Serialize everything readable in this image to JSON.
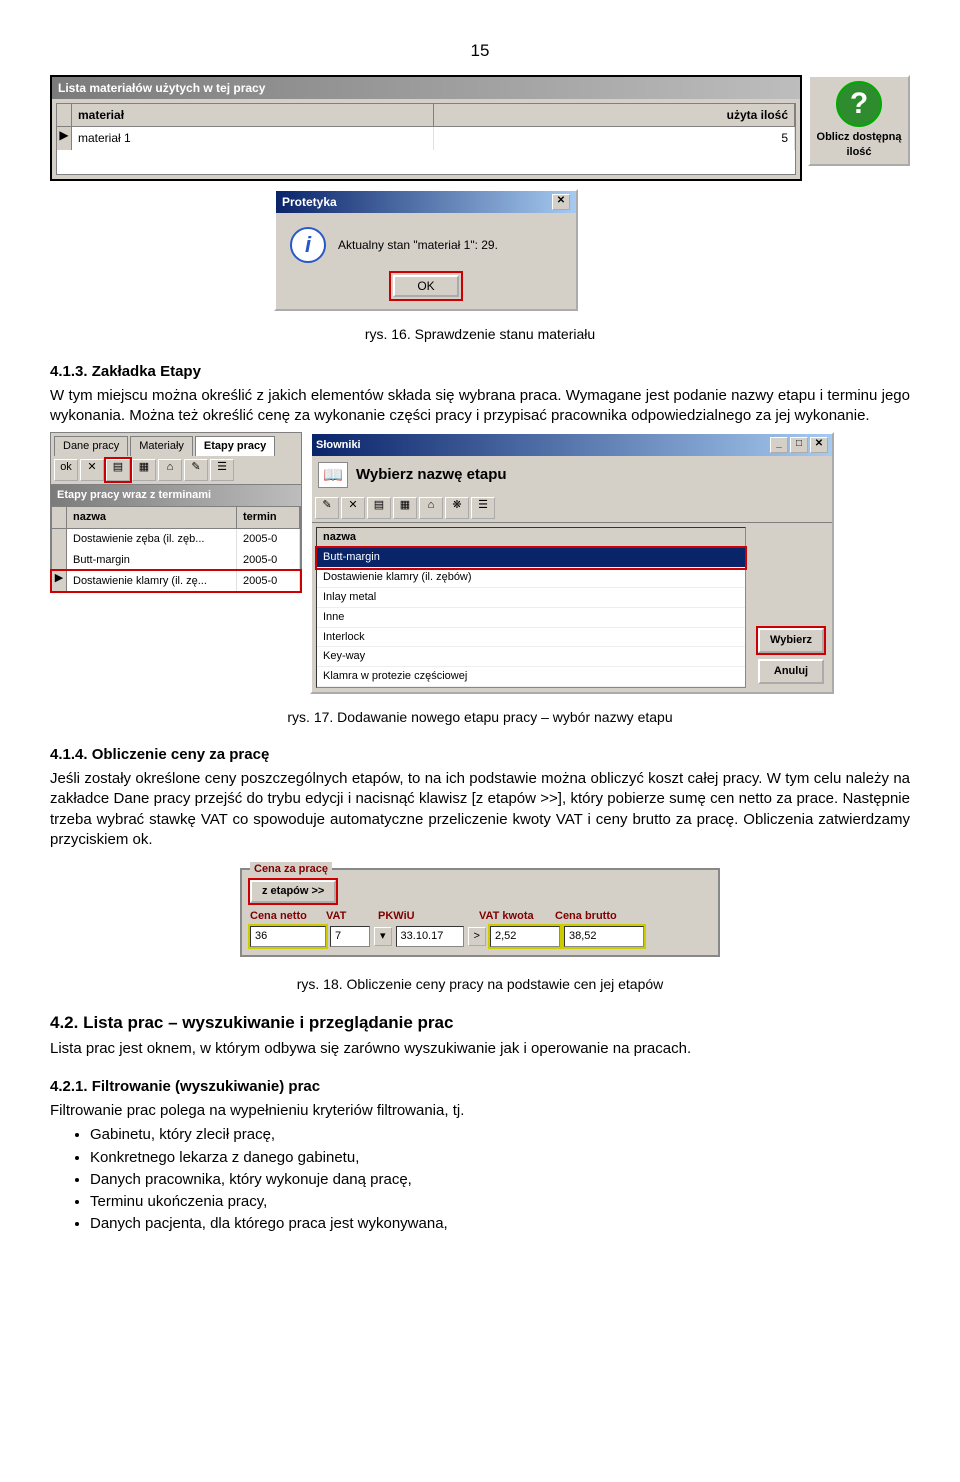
{
  "page_number": "15",
  "fig16": {
    "panel_title": "Lista materiałów użytych w tej pracy",
    "col_material": "materiał",
    "col_qty": "użyta ilość",
    "row_material": "materiał 1",
    "row_qty": "5",
    "oblicz_btn": "Oblicz dostępną ilość",
    "dialog_title": "Protetyka",
    "dialog_msg": "Aktualny stan \"materiał 1\": 29.",
    "ok": "OK",
    "caption": "rys. 16. Sprawdzenie stanu materiału"
  },
  "sec413": {
    "title": "4.1.3. Zakładka Etapy",
    "p1": "W tym miejscu można określić z jakich elementów składa się wybrana praca. Wymagane jest podanie nazwy etapu i terminu jego wykonania. Można też określić cenę za wykonanie części pracy i przypisać pracownika odpowiedzialnego za jej wykonanie."
  },
  "fig17": {
    "tabs": {
      "t1": "Dane pracy",
      "t2": "Materiały",
      "t3": "Etapy pracy"
    },
    "left_panel_title": "Etapy pracy wraz z terminami",
    "left_col1": "nazwa",
    "left_col2": "termin",
    "left_rows": [
      {
        "n": "Dostawienie zęba (il. zęb...",
        "t": "2005-0"
      },
      {
        "n": "Butt-margin",
        "t": "2005-0"
      },
      {
        "n": "Dostawienie klamry (il. zę...",
        "t": "2005-0"
      }
    ],
    "slowniki_title": "Słowniki",
    "wybierz_hdr": "Wybierz nazwę etapu",
    "col_nazwa": "nazwa",
    "rows": [
      "Butt-margin",
      "Dostawienie klamry (il. zębów)",
      "Inlay metal",
      "Inne",
      "Interlock",
      "Key-way",
      "Klamra w protezie częściowej"
    ],
    "btn_wybierz": "Wybierz",
    "btn_anuluj": "Anuluj",
    "caption": "rys. 17. Dodawanie nowego etapu pracy – wybór nazwy etapu"
  },
  "sec414": {
    "title": "4.1.4. Obliczenie ceny za pracę",
    "p1": "Jeśli zostały określone ceny poszczególnych etapów, to na ich podstawie można obliczyć koszt całej pracy. W tym celu należy na zakładce Dane pracy przejść do trybu edycji i nacisnąć klawisz [z etapów >>], który pobierze sumę cen netto za prace. Następnie trzeba wybrać stawkę VAT co spowoduje automatyczne przeliczenie kwoty VAT i ceny brutto za pracę. Obliczenia zatwierdzamy przyciskiem ok."
  },
  "fig18": {
    "legend": "Cena za pracę",
    "zetapow": "z etapów >>",
    "labels": {
      "netto": "Cena netto",
      "vat": "VAT",
      "pkwiu": "PKWiU",
      "vatkwota": "VAT kwota",
      "brutto": "Cena brutto"
    },
    "vals": {
      "netto": "36",
      "vat": "7",
      "pkwiu": "33.10.17",
      "vatkwota": "2,52",
      "brutto": "38,52"
    },
    "caption": "rys. 18. Obliczenie ceny pracy na podstawie cen jej etapów"
  },
  "sec42": {
    "title": "4.2. Lista prac – wyszukiwanie i przeglądanie prac",
    "p1": "Lista prac jest oknem, w którym odbywa się zarówno wyszukiwanie jak i operowanie na pracach."
  },
  "sec421": {
    "title": "4.2.1. Filtrowanie (wyszukiwanie) prac",
    "p1": "Filtrowanie prac polega na wypełnieniu kryteriów filtrowania, tj.",
    "items": [
      "Gabinetu, który zlecił pracę,",
      "Konkretnego lekarza z danego gabinetu,",
      "Danych pracownika, który wykonuje daną pracę,",
      "Terminu ukończenia pracy,",
      "Danych pacjenta, dla którego praca jest wykonywana,"
    ]
  }
}
